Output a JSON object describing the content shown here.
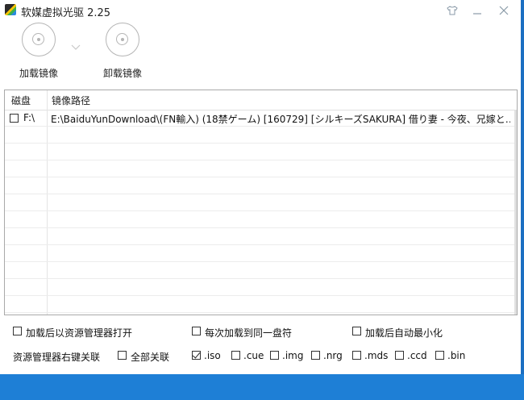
{
  "window": {
    "title": "软媒虚拟光驱 2.25"
  },
  "toolbar": {
    "mount_label": "加载镜像",
    "unmount_label": "卸载镜像"
  },
  "table": {
    "headers": {
      "drive": "磁盘",
      "path": "镜像路径"
    },
    "rows": [
      {
        "checked": false,
        "drive": "F:\\",
        "path": "E:\\BaiduYunDownload\\(FN輸入) (18禁ゲーム) [160729] [シルキーズSAKURA] 借り妻 - 今夜、兄嫁と…"
      }
    ]
  },
  "options": {
    "open_explorer": {
      "label": "加载后以资源管理器打开",
      "checked": false
    },
    "same_drive": {
      "label": "每次加载到同一盘符",
      "checked": false
    },
    "auto_minimize": {
      "label": "加载后自动最小化",
      "checked": false
    },
    "assoc_label": "资源管理器右键关联",
    "all_assoc": {
      "label": "全部关联",
      "checked": false
    },
    "extensions": [
      {
        "label": ".iso",
        "checked": true
      },
      {
        "label": ".cue",
        "checked": false
      },
      {
        "label": ".img",
        "checked": false
      },
      {
        "label": ".nrg",
        "checked": false
      },
      {
        "label": ".mds",
        "checked": false
      },
      {
        "label": ".ccd",
        "checked": false
      },
      {
        "label": ".bin",
        "checked": false
      }
    ]
  },
  "colors": {
    "accent": "#1e7fd6",
    "border": "#a9a9a9"
  }
}
